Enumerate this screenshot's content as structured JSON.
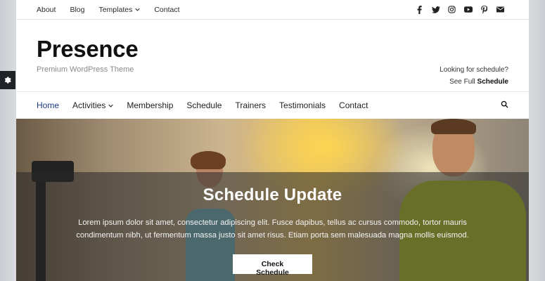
{
  "top_menu": {
    "items": [
      {
        "label": "About"
      },
      {
        "label": "Blog"
      },
      {
        "label": "Templates"
      },
      {
        "label": "Contact"
      }
    ]
  },
  "social_icons": [
    "facebook-icon",
    "twitter-icon",
    "instagram-icon",
    "youtube-icon",
    "pinterest-icon",
    "email-icon"
  ],
  "header": {
    "site_title": "Presence",
    "tagline": "Premium WordPress Theme",
    "note_line1": "Looking for schedule?",
    "note_prefix": "See Full",
    "note_link": "Schedule"
  },
  "main_nav": {
    "items": [
      {
        "label": "Home"
      },
      {
        "label": "Activities"
      },
      {
        "label": "Membership"
      },
      {
        "label": "Schedule"
      },
      {
        "label": "Trainers"
      },
      {
        "label": "Testimonials"
      },
      {
        "label": "Contact"
      }
    ],
    "active_color": "#1e3a8a"
  },
  "hero": {
    "title": "Schedule Update",
    "text": "Lorem ipsum dolor sit amet, consectetur adipiscing elit. Fusce dapibus, tellus ac cursus commodo, tortor mauris condimentum nibh, ut fermentum massa justo sit amet risus. Etiam porta sem malesuada magna mollis euismod.",
    "button_label": "Check Schedule"
  }
}
